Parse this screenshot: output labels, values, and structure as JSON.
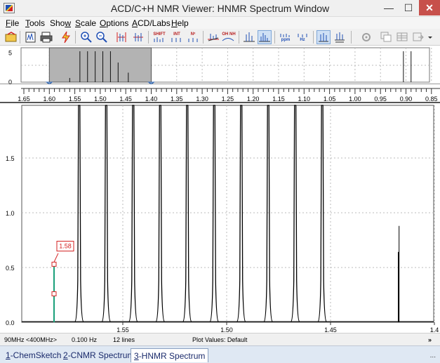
{
  "window": {
    "title": "ACD/C+H NMR Viewer: HNMR Spectrum Window",
    "minimize_glyph": "—",
    "maximize_glyph": "☐",
    "close_glyph": "✕"
  },
  "menu": [
    {
      "underline": "F",
      "rest": "ile"
    },
    {
      "underline": "T",
      "rest": "ools"
    },
    {
      "pre": "Sho",
      "underline": "w",
      "rest": ""
    },
    {
      "underline": "S",
      "rest": "cale"
    },
    {
      "underline": "O",
      "rest": "ptions"
    },
    {
      "underline": "A",
      "rest": "CD/Labs"
    },
    {
      "underline": "H",
      "rest": "elp"
    }
  ],
  "toolbar": {
    "shift_label": "SHIFT",
    "int_label": "INT",
    "nx_label": "Nˣ",
    "oh_nh_label": "OH NH",
    "ppm_label": "ppm",
    "hz_label": "Hz",
    "accent": "#d32020",
    "blue": "#1f4fb5"
  },
  "overview": {
    "y_ticks": [
      "5",
      "0"
    ],
    "selected_range_ppm": [
      1.6,
      1.4
    ]
  },
  "ruler": {
    "ticks": [
      "1.65",
      "1.60",
      "1.55",
      "1.50",
      "1.45",
      "1.40",
      "1.35",
      "1.30",
      "1.25",
      "1.20",
      "1.15",
      "1.10",
      "1.05",
      "1.00",
      "0.95",
      "0.90",
      "0.85"
    ]
  },
  "main_plot": {
    "y_ticks": [
      "1.5",
      "1.0",
      "0.5",
      "0.0"
    ],
    "x_ticks": [
      "1.55",
      "1.50",
      "1.45",
      "1.4"
    ],
    "cursor_label": "1.58"
  },
  "chart_data": {
    "type": "line",
    "title": "",
    "xlabel": "",
    "ylabel": "",
    "x_unit": "ppm",
    "xlim": [
      1.59,
      1.4
    ],
    "ylim": [
      0,
      2.05
    ],
    "reversed_x": true,
    "series": [
      {
        "values": [
          {
            "ppm": 1.571,
            "intensity": 2.0
          },
          {
            "ppm": 1.558,
            "intensity": 2.0
          },
          {
            "ppm": 1.545,
            "intensity": 2.0
          },
          {
            "ppm": 1.532,
            "intensity": 2.0
          },
          {
            "ppm": 1.519,
            "intensity": 2.0
          },
          {
            "ppm": 1.506,
            "intensity": 2.0
          },
          {
            "ppm": 1.493,
            "intensity": 2.0
          },
          {
            "ppm": 1.48,
            "intensity": 2.0
          },
          {
            "ppm": 1.467,
            "intensity": 2.0
          },
          {
            "ppm": 1.454,
            "intensity": 2.0
          },
          {
            "ppm": 1.417,
            "intensity": 0.88
          }
        ]
      }
    ],
    "overview_series": {
      "values": [
        {
          "ppm": 1.56,
          "intensity": 0.7
        },
        {
          "ppm": 1.54,
          "intensity": 5.2
        },
        {
          "ppm": 1.525,
          "intensity": 5.2
        },
        {
          "ppm": 1.51,
          "intensity": 5.2
        },
        {
          "ppm": 1.495,
          "intensity": 5.2
        },
        {
          "ppm": 1.48,
          "intensity": 5.2
        },
        {
          "ppm": 1.465,
          "intensity": 3.3
        },
        {
          "ppm": 1.445,
          "intensity": 1.6
        },
        {
          "ppm": 0.905,
          "intensity": 5.2
        },
        {
          "ppm": 0.89,
          "intensity": 5.2
        }
      ]
    }
  },
  "status": {
    "freq": "90MHz <400MHz>",
    "resolution": "0.100 Hz",
    "lines": "12 lines",
    "plot_values": "Plot Values: Default",
    "more": "»"
  },
  "tabs": [
    {
      "num": "1",
      "label": "-ChemSketch"
    },
    {
      "num": "2",
      "label": "-CNMR Spectrum"
    },
    {
      "num": "3",
      "label": "-HNMR Spectrum"
    }
  ],
  "tab_more": "..."
}
